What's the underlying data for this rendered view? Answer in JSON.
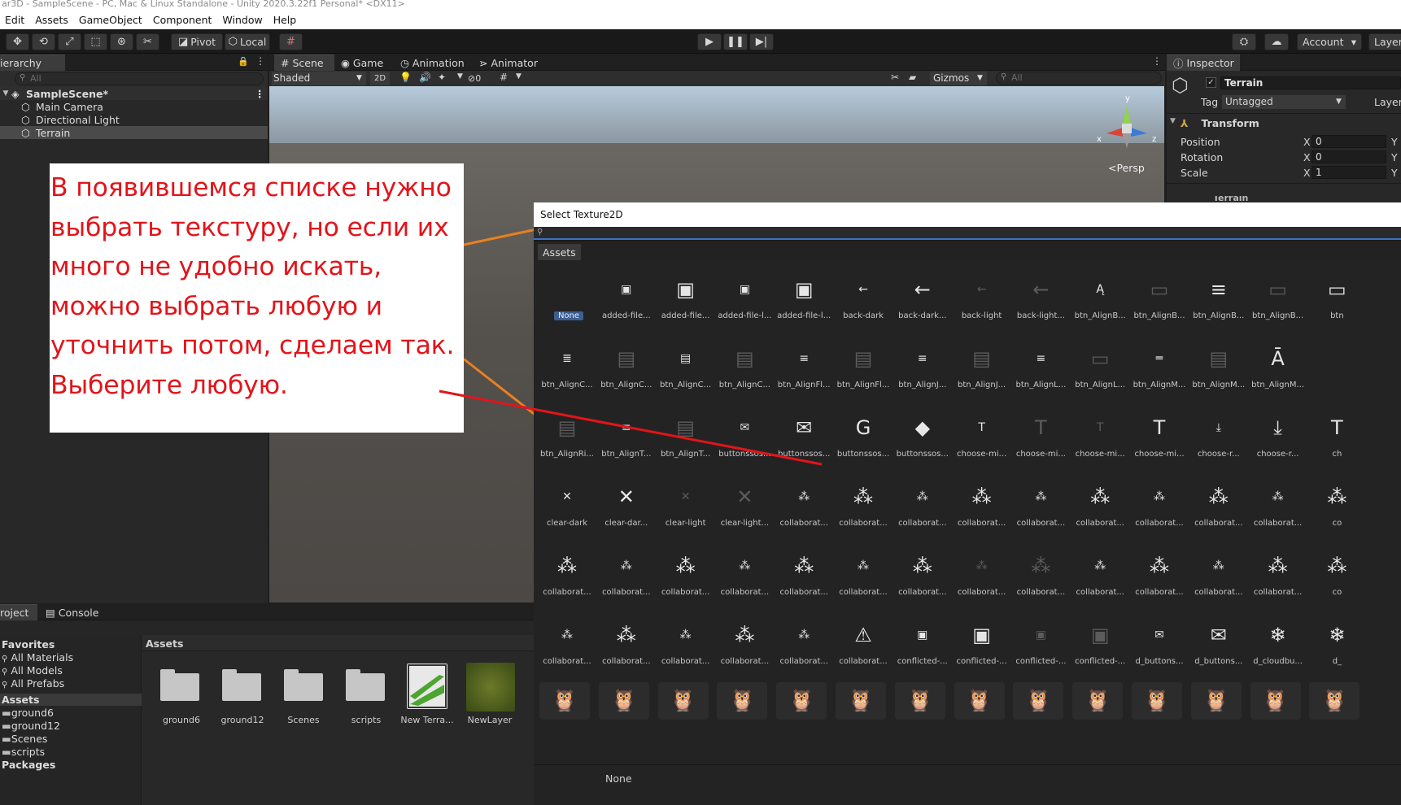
{
  "window": {
    "title": "ar3D - SampleScene - PC, Mac & Linux Standalone - Unity 2020.3.22f1 Personal* <DX11>"
  },
  "menu": [
    "Edit",
    "Assets",
    "GameObject",
    "Component",
    "Window",
    "Help"
  ],
  "toolbar": {
    "pivot_label": "Pivot",
    "local_label": "Local",
    "account_label": "Account",
    "layers_label": "Layers"
  },
  "hierarchy": {
    "tab_label": "ierarchy",
    "search_placeholder": "All",
    "scene_name": "SampleScene*",
    "items": [
      "Main Camera",
      "Directional Light",
      "Terrain"
    ]
  },
  "scene_view": {
    "tabs": [
      "Scene",
      "Game",
      "Animation",
      "Animator"
    ],
    "shading_mode": "Shaded",
    "mode_2d": "2D",
    "hidden_count": "0",
    "gizmos_label": "Gizmos",
    "search_placeholder": "All",
    "persp_label": "Persp",
    "axis_x": "x",
    "axis_y": "y",
    "axis_z": "z"
  },
  "callout": {
    "lines": [
      "В появившемся списке нужно",
      "выбрать текстуру, но если их",
      "много не удобно искать,",
      "можно выбрать любую и",
      "уточнить потом, сделаем так.",
      "Выберите любую."
    ],
    "arrow_color": "#e3141a"
  },
  "picker": {
    "title": "Select Texture2D",
    "tab_label": "Assets",
    "footer_selection": "None",
    "selection_color": "#3b5f93",
    "grid": [
      [
        "None",
        "added-file...",
        "added-file...",
        "added-file-l...",
        "added-file-l...",
        "back-dark",
        "back-dark...",
        "back-light",
        "back-light...",
        "btn_AlignB...",
        "btn_AlignB...",
        "btn_AlignB...",
        "btn_AlignB...",
        "btn"
      ],
      [
        "btn_AlignC...",
        "btn_AlignC...",
        "btn_AlignC...",
        "btn_AlignC...",
        "btn_AlignFl...",
        "btn_AlignFl...",
        "btn_AlignJ...",
        "btn_AlignJ...",
        "btn_AlignL...",
        "btn_AlignL...",
        "btn_AlignM...",
        "btn_AlignM...",
        "btn_AlignM..."
      ],
      [
        "btn_AlignRi...",
        "btn_AlignT...",
        "btn_AlignT...",
        "buttonssos...",
        "buttonssos...",
        "buttonssos...",
        "buttonssos...",
        "choose-mi...",
        "choose-mi...",
        "choose-mi...",
        "choose-mi...",
        "choose-r...",
        "choose-r...",
        "ch"
      ],
      [
        "clear-dark",
        "clear-dar...",
        "clear-light",
        "clear-light...",
        "collaborat...",
        "collaborat...",
        "collaborat...",
        "collaborat...",
        "collaborat...",
        "collaborat...",
        "collaborat...",
        "collaborat...",
        "collaborat...",
        "co"
      ],
      [
        "collaborat...",
        "collaborat...",
        "collaborat...",
        "collaborat...",
        "collaborat...",
        "collaborat...",
        "collaborat...",
        "collaborat...",
        "collaborat...",
        "collaborat...",
        "collaborat...",
        "collaborat...",
        "collaborat...",
        "co"
      ],
      [
        "collaborat...",
        "collaborat...",
        "collaborat...",
        "collaborat...",
        "collaborat...",
        "collaborat...",
        "conflicted-...",
        "conflicted-...",
        "conflicted-...",
        "conflicted-...",
        "d_buttons...",
        "d_buttons...",
        "d_cloudbu...",
        "d_"
      ]
    ]
  },
  "project": {
    "tabs": [
      "roject",
      "Console"
    ],
    "favorites_header": "Favorites",
    "favorites": [
      "All Materials",
      "All Models",
      "All Prefabs"
    ],
    "assets_header": "Assets",
    "asset_folders": [
      "ground6",
      "ground12",
      "Scenes",
      "scripts"
    ],
    "packages_label": "Packages",
    "breadcrumb": "Assets",
    "asset_items": [
      "ground6",
      "ground12",
      "Scenes",
      "scripts",
      "New Terra...",
      "NewLayer"
    ]
  },
  "inspector": {
    "tab_label": "Inspector",
    "object_name": "Terrain",
    "tag_label": "Tag",
    "tag_value": "Untagged",
    "layer_label": "Layer",
    "transform_label": "Transform",
    "fields": [
      {
        "label": "Position",
        "axis": "X",
        "value": "0",
        "next_axis": "Y"
      },
      {
        "label": "Rotation",
        "axis": "X",
        "value": "0",
        "next_axis": "Y"
      },
      {
        "label": "Scale",
        "axis": "X",
        "value": "1",
        "next_axis": "Y"
      }
    ],
    "terrain_component": "Terrain"
  }
}
